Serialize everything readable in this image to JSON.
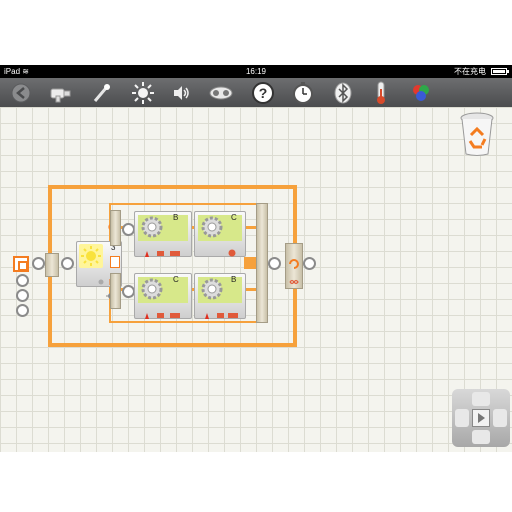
{
  "status_bar": {
    "device": "iPad",
    "time": "16:19",
    "charging": "不在充电"
  },
  "toolbar": {
    "items": [
      {
        "name": "back-icon"
      },
      {
        "name": "motor-block-icon"
      },
      {
        "name": "touch-sensor-icon"
      },
      {
        "name": "light-sensor-icon"
      },
      {
        "name": "sound-sensor-icon"
      },
      {
        "name": "ultrasonic-sensor-icon"
      },
      {
        "name": "help-icon"
      },
      {
        "name": "timer-icon"
      },
      {
        "name": "bluetooth-icon"
      },
      {
        "name": "thermometer-icon"
      },
      {
        "name": "color-sensor-icon"
      }
    ]
  },
  "program": {
    "switch_value": "3",
    "top_branch": {
      "motor1_port": "B",
      "motor2_port": "C"
    },
    "bottom_branch": {
      "motor1_port": "C",
      "motor2_port": "B"
    }
  },
  "colors": {
    "accent": "#f6a13c",
    "block_green": "#d7e88a",
    "switch_yellow": "#fff59a"
  }
}
